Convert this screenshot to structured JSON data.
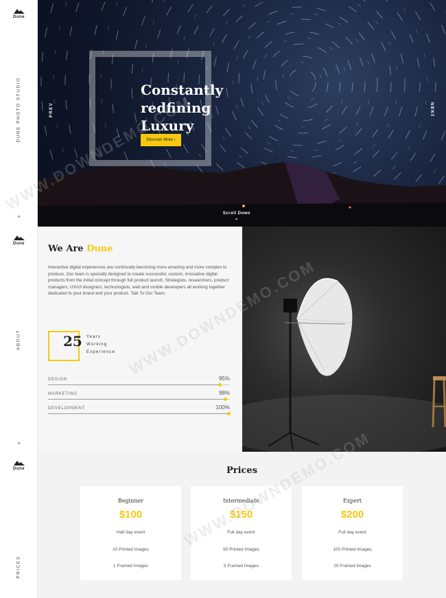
{
  "brand": {
    "name": "Dune"
  },
  "sidebar": {
    "section1_label": "DUNE PHOTO STUDIO",
    "section2_label": "ABOUT",
    "section3_label": "PRICES",
    "menu_glyph": "≡"
  },
  "hero": {
    "title": "Constantly\nredfining\nLuxury",
    "cta_label": "Discover More ›",
    "prev_label": "PREV",
    "next_label": "NEXT",
    "scroll_label": "Scroll Down",
    "scroll_icon": "chevron-down-icon"
  },
  "about": {
    "heading_prefix": "We Are ",
    "heading_accent": "Dune",
    "intro": "Interactive digital experiences are continually becoming more amazing and more complex to produce. Our team is specially designed to create successful, custom, innovative digital products from the initial concept through full product launch. Strategists, researchers, product managers, UX/UI designers, technologists, web and mobile developers all working together dedicated to your brand and your product. Talk To Our Team.",
    "years_number": "25",
    "years_label": "Years\nWorking\nExperience",
    "skills": [
      {
        "name": "DESIGN",
        "percent_label": "95%",
        "value": 95
      },
      {
        "name": "MARKETING",
        "percent_label": "98%",
        "value": 98
      },
      {
        "name": "DEVELOPMENT",
        "percent_label": "100%",
        "value": 100
      }
    ]
  },
  "prices": {
    "heading": "Prices",
    "plans": [
      {
        "name": "Beginner",
        "price": "$100",
        "features": [
          "Half day event",
          "10 Printed Images",
          "1 Framed Images"
        ]
      },
      {
        "name": "Intermediate",
        "price": "$150",
        "features": [
          "Full day event",
          "50 Printed Images",
          "5 Framed Images"
        ]
      },
      {
        "name": "Expert",
        "price": "$200",
        "features": [
          "Full day event",
          "100 Printed Images",
          "20 Framed Images"
        ]
      }
    ]
  },
  "watermark": "WWW.DOWNDEMO.COM",
  "colors": {
    "accent": "#f6c90e",
    "hero_bg": "#141d33",
    "dark": "#222222"
  }
}
